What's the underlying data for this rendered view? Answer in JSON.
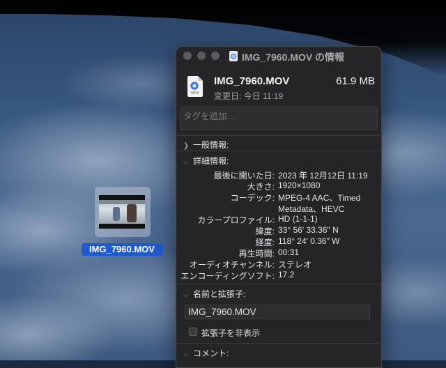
{
  "desktop": {
    "file_label": "IMG_7960.MOV"
  },
  "window": {
    "title": "IMG_7960.MOV の情報",
    "file_name": "IMG_7960.MOV",
    "file_size": "61.9 MB",
    "modified": "変更日: 今日 11:19",
    "file_icon_ext": "MOV",
    "tags_placeholder": "タグを追加...",
    "sections": {
      "general": "一般情報:",
      "details": "詳細情報:",
      "name_ext": "名前と拡張子:",
      "comments": "コメント:"
    },
    "details": [
      {
        "key": "最後に開いた日:",
        "value": "2023 年 12月12日 11:19"
      },
      {
        "key": "大きさ:",
        "value": "1920×1080"
      },
      {
        "key": "コーデック:",
        "value": "MPEG-4 AAC、Timed"
      },
      {
        "key": "",
        "value": "Metadata、HEVC"
      },
      {
        "key": "カラープロファイル:",
        "value": "HD (1-1-1)"
      },
      {
        "key": "緯度:",
        "value": "33° 56' 33.36\" N"
      },
      {
        "key": "経度:",
        "value": "118° 24' 0.36\" W"
      },
      {
        "key": "再生時間:",
        "value": "00:31"
      },
      {
        "key": "オーディオチャンネル:",
        "value": "ステレオ"
      },
      {
        "key": "エンコーディングソフト:",
        "value": "17.2"
      }
    ],
    "name_field_value": "IMG_7960.MOV",
    "hide_extension_label": "拡張子を非表示",
    "hide_extension_checked": false
  },
  "colors": {
    "selection": "#1f5bd0",
    "window_bg": "#252527"
  }
}
